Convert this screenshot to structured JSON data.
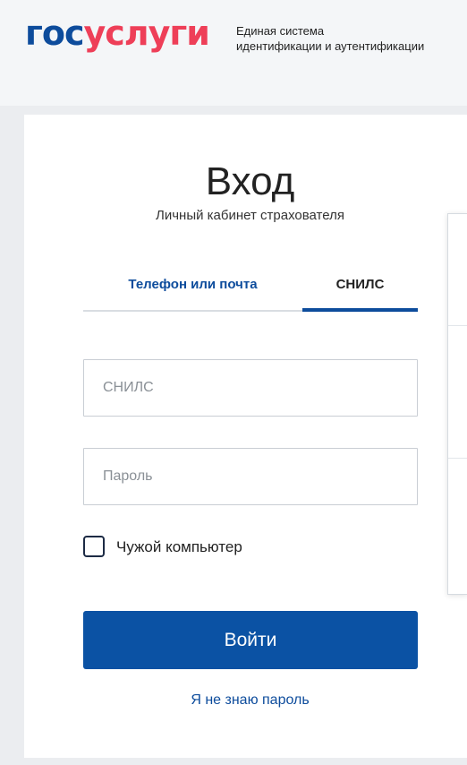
{
  "header": {
    "logo_part1": "гос",
    "logo_part2": "услуги",
    "tagline_line1": "Единая система",
    "tagline_line2": "идентификации и аутентификации"
  },
  "login": {
    "title": "Вход",
    "subtitle": "Личный кабинет страхователя",
    "tabs": [
      {
        "label": "Телефон или почта",
        "active": false
      },
      {
        "label": "СНИЛС",
        "active": true
      }
    ],
    "snils_placeholder": "СНИЛС",
    "snils_value": "",
    "password_placeholder": "Пароль",
    "password_value": "",
    "remember_label": "Чужой компьютер",
    "remember_checked": false,
    "submit_label": "Войти",
    "forgot_label": "Я не знаю пароль"
  },
  "colors": {
    "brand_blue": "#0d4c9c",
    "brand_red": "#ee3f58",
    "button": "#0b52a4"
  }
}
